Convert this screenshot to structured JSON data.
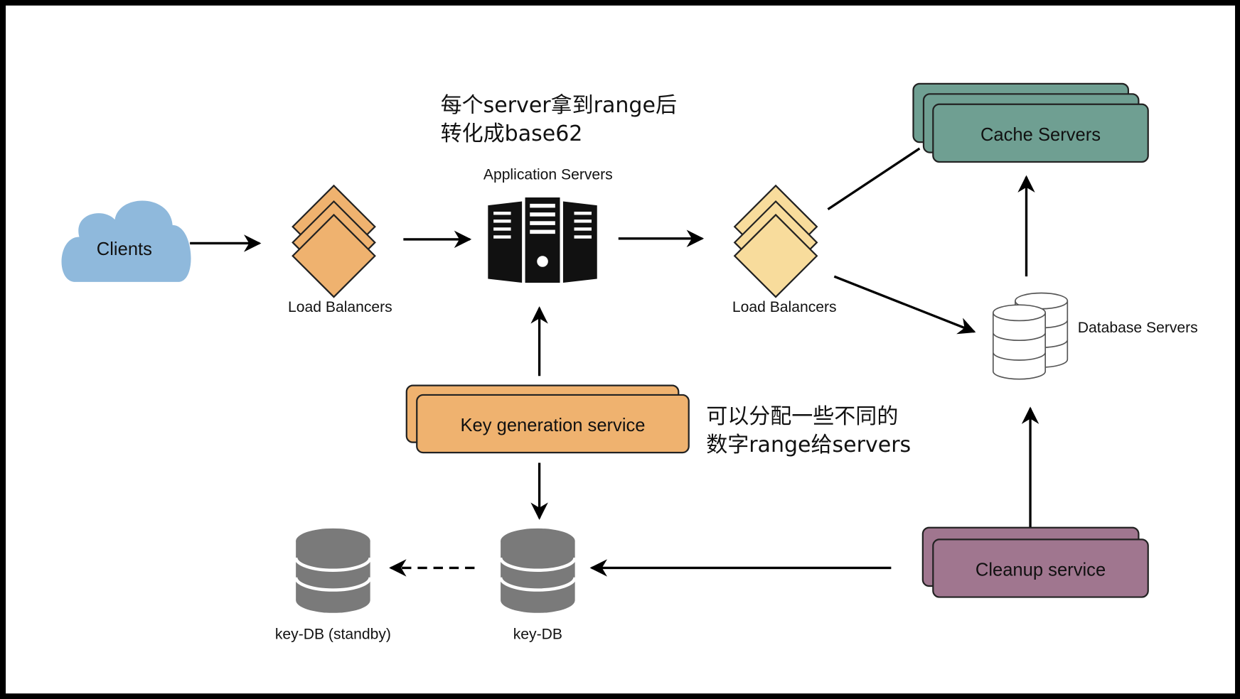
{
  "nodes": {
    "clients": "Clients",
    "lb_left": "Load Balancers",
    "app_servers": "Application Servers",
    "lb_right": "Load Balancers",
    "cache_servers": "Cache Servers",
    "database_servers": "Database Servers",
    "key_generation": "Key generation service",
    "key_db": "key-DB",
    "key_db_standby": "key-DB (standby)",
    "cleanup": "Cleanup service"
  },
  "annotations": {
    "app_note": [
      "每个server拿到range后",
      "转化成base62"
    ],
    "kgs_note": [
      "可以分配一些不同的",
      "数字range给servers"
    ]
  },
  "colors": {
    "cloud": "#8fb9dc",
    "lb_left": "#efb26f",
    "lb_right": "#f8dc9c",
    "cache": "#6f9f92",
    "key_generation": "#efb26f",
    "cleanup": "#a0768f",
    "key_db": "#7a7a7a",
    "server": "#111111",
    "frame": "#000000"
  }
}
